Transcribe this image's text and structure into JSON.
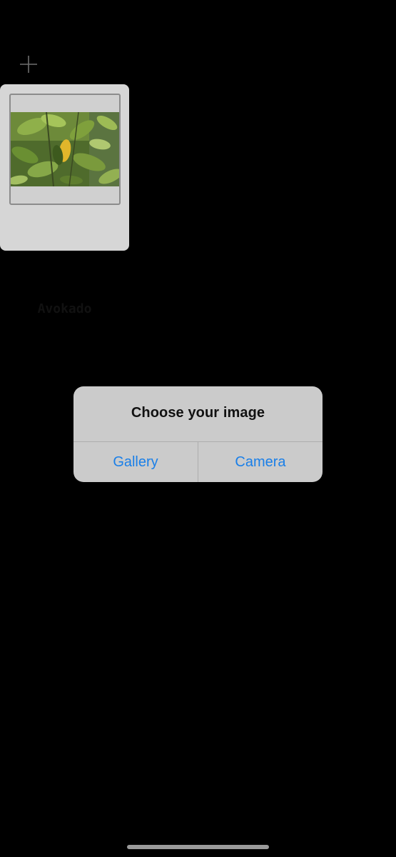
{
  "toolbar": {
    "add_icon": "plus-icon"
  },
  "plants": [
    {
      "name": "Avokado",
      "photo": "plant-leaves-photo"
    }
  ],
  "dialog": {
    "title": "Choose your image",
    "buttons": {
      "gallery": "Gallery",
      "camera": "Camera"
    }
  },
  "colors": {
    "background": "#000000",
    "card": "#d6d6d6",
    "dialog": "#cbcbcb",
    "accent": "#1a7fe8"
  }
}
